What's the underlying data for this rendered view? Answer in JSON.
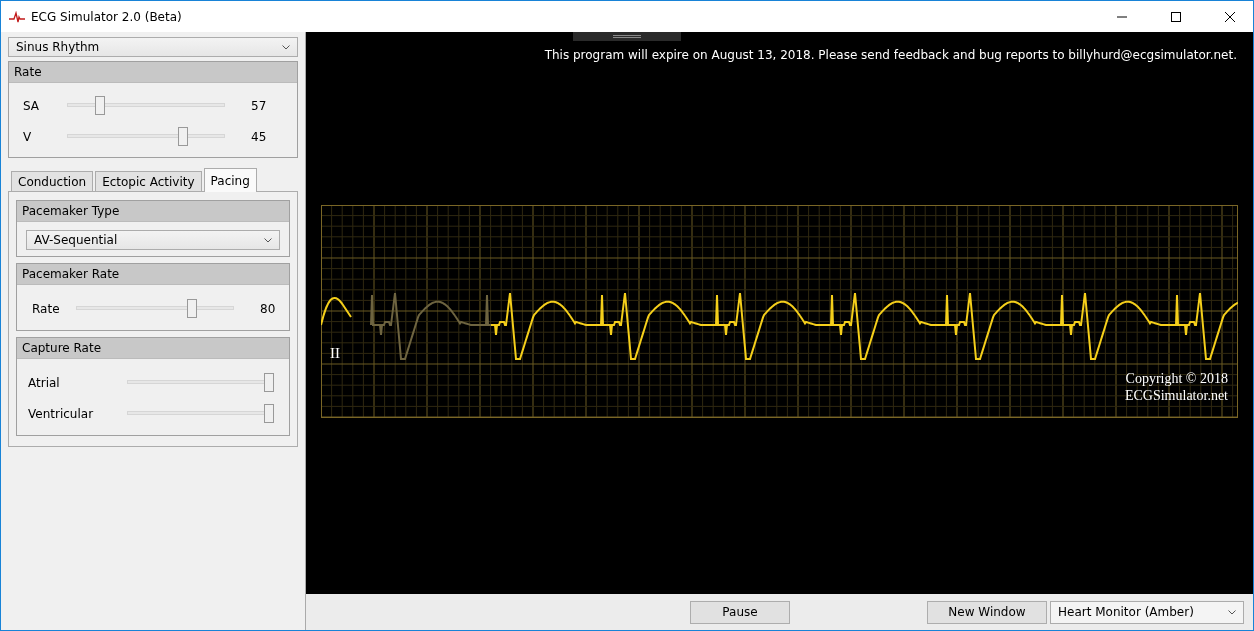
{
  "window": {
    "title": "ECG Simulator 2.0 (Beta)"
  },
  "rhythm_select": {
    "value": "Sinus Rhythm"
  },
  "rate_group": {
    "title": "Rate",
    "sliders": [
      {
        "label": "SA",
        "level": 0.19,
        "reading": "57"
      },
      {
        "label": "V",
        "level": 0.75,
        "reading": "45"
      }
    ]
  },
  "tabs": [
    {
      "label": "Conduction",
      "selected": false
    },
    {
      "label": "Ectopic Activity",
      "selected": false
    },
    {
      "label": "Pacing",
      "selected": true
    }
  ],
  "pacing": {
    "groups": [
      {
        "kind": "select",
        "title": "Pacemaker Type",
        "value": "AV-Sequential"
      },
      {
        "kind": "sliders",
        "title": "Pacemaker Rate",
        "sliders": [
          {
            "label": "Rate",
            "level": 0.75,
            "reading": "80"
          }
        ]
      },
      {
        "kind": "wide-sliders",
        "title": "Capture Rate",
        "sliders": [
          {
            "label": "Atrial",
            "level": 1
          },
          {
            "label": "Ventricular",
            "level": 1
          }
        ]
      }
    ]
  },
  "notice": "This program will expire on August 13, 2018.  Please send feedback and bug reports to billyhurd@ecgsimulator.net.",
  "strip": {
    "lead": "II",
    "copyright": [
      "Copyright © 2018",
      "ECGSimulator.net"
    ]
  },
  "buttons": [
    {
      "label": "Pause"
    },
    {
      "label": "New Window"
    }
  ],
  "monitor_select": {
    "value": "Heart Monitor (Amber)"
  }
}
